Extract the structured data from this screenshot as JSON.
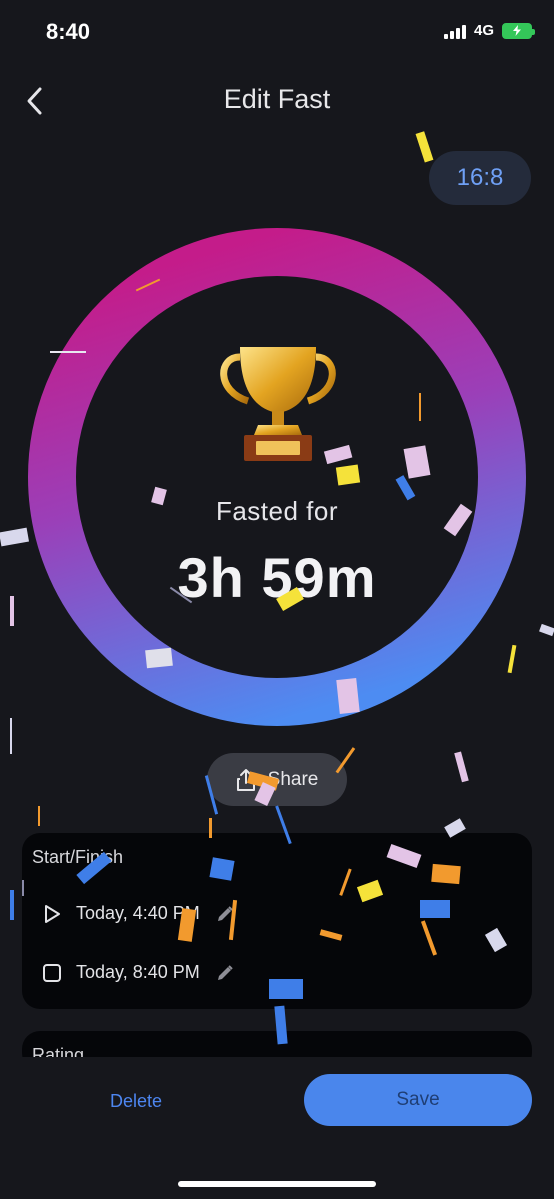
{
  "status_bar": {
    "time": "8:40",
    "network": "4G",
    "signal_icon": "cellular-signal-icon",
    "battery_icon": "battery-charging-icon"
  },
  "nav": {
    "back_icon": "chevron-left-icon",
    "title": "Edit Fast"
  },
  "plan": {
    "label": "16:8"
  },
  "summary": {
    "icon": "trophy-icon",
    "label": "Fasted for",
    "value": "3h 59m"
  },
  "share": {
    "icon": "share-icon",
    "label": "Share"
  },
  "start_finish": {
    "title": "Start/Finish",
    "start": {
      "icon": "play-icon",
      "value": "Today, 4:40 PM",
      "edit_icon": "pencil-icon"
    },
    "finish": {
      "icon": "stop-square-icon",
      "value": "Today, 8:40 PM",
      "edit_icon": "pencil-icon"
    }
  },
  "rating": {
    "title": "Rating"
  },
  "actions": {
    "delete_label": "Delete",
    "save_label": "Save"
  },
  "colors": {
    "background": "#16171c",
    "card": "#050609",
    "accent_blue": "#4a86ec",
    "ring_start": "#c41c8a",
    "ring_end": "#4d8cf2",
    "battery_green": "#34c759"
  }
}
